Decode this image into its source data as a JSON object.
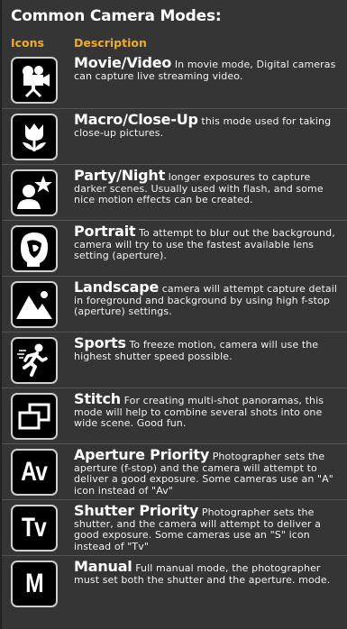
{
  "title": "Common Camera Modes:",
  "columns": {
    "icons": "Icons",
    "description": "Description"
  },
  "modes": [
    {
      "name": "Movie/Video",
      "icon": "movie-camera-icon",
      "desc": "In movie mode, Digital cameras can capture live streaming video."
    },
    {
      "name": "Macro/Close-Up",
      "icon": "flower-icon",
      "desc": "this mode used for taking close-up pictures."
    },
    {
      "name": "Party/Night",
      "icon": "person-star-icon",
      "desc": "longer exposures to capture darker scenes. Usually used with flash, and some nice motion effects can be created."
    },
    {
      "name": "Portrait",
      "icon": "portrait-head-icon",
      "desc": "To attempt to blur out the background, camera will try to use the fastest available lens setting (aperture)."
    },
    {
      "name": "Landscape",
      "icon": "mountain-icon",
      "desc": "camera will attempt capture detail in foreground and background by using high f-stop (aperture) settings."
    },
    {
      "name": "Sports",
      "icon": "running-person-icon",
      "desc": "To freeze motion, camera will use the highest shutter speed possible."
    },
    {
      "name": "Stitch",
      "icon": "stitch-frames-icon",
      "desc": "For creating multi-shot panoramas, this mode will help to combine several shots into one wide scene. Good fun."
    },
    {
      "name": "Aperture Priority",
      "icon": "av-icon",
      "icon_text": "Av",
      "desc": "Photographer sets the aperture (f-stop) and the camera will attempt to deliver a good exposure. Some cameras use an \"A\" icon instead of \"Av\""
    },
    {
      "name": "Shutter Priority",
      "icon": "tv-icon",
      "icon_text": "Tv",
      "desc": "Photographer sets the shutter, and the camera will attempt to deliver a good exposure. Some cameras use an \"S\" icon instead of \"Tv\""
    },
    {
      "name": "Manual",
      "icon": "m-icon",
      "icon_text": "M",
      "desc": "Full manual mode, the photographer must set both the shutter and the aperture. mode."
    }
  ],
  "colors": {
    "background": "#353535",
    "heading_accent": "#f0ad1b",
    "text": "#f2f2f2",
    "icon_border": "#cfcfcf"
  }
}
